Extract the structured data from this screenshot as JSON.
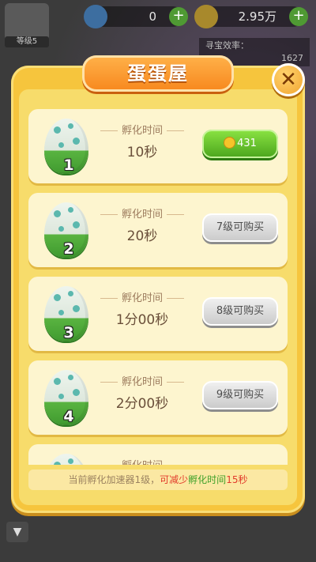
{
  "topbar": {
    "level_tag": "等级5",
    "gem_value": "0",
    "coin_value": "2.95万",
    "plus": "+",
    "side_info": [
      "寻宝效率：",
      "1627"
    ]
  },
  "modal": {
    "title": "蛋蛋屋",
    "close_glyph": "✕",
    "hatch_label": "孵化时间",
    "eggs": [
      {
        "num": "1",
        "time": "10秒",
        "button": "431",
        "button_type": "coin"
      },
      {
        "num": "2",
        "time": "20秒",
        "button": "7级可购买",
        "button_type": "locked"
      },
      {
        "num": "3",
        "time": "1分00秒",
        "button": "8级可购买",
        "button_type": "locked"
      },
      {
        "num": "4",
        "time": "2分00秒",
        "button": "9级可购买",
        "button_type": "locked"
      },
      {
        "num": "",
        "time": "",
        "button": "",
        "button_type": "partial"
      }
    ],
    "footer": {
      "prefix": "当前孵化加速器1级，",
      "reduce": "可减少",
      "hatch": "孵化时间",
      "amount": "15秒"
    }
  },
  "colors": {
    "modal_bg": "#f6c53d",
    "card_bg": "#fdf5cf",
    "green_button": "#4aa41c",
    "gray_button": "#c9c9c9",
    "title_orange": "#f7871d"
  }
}
